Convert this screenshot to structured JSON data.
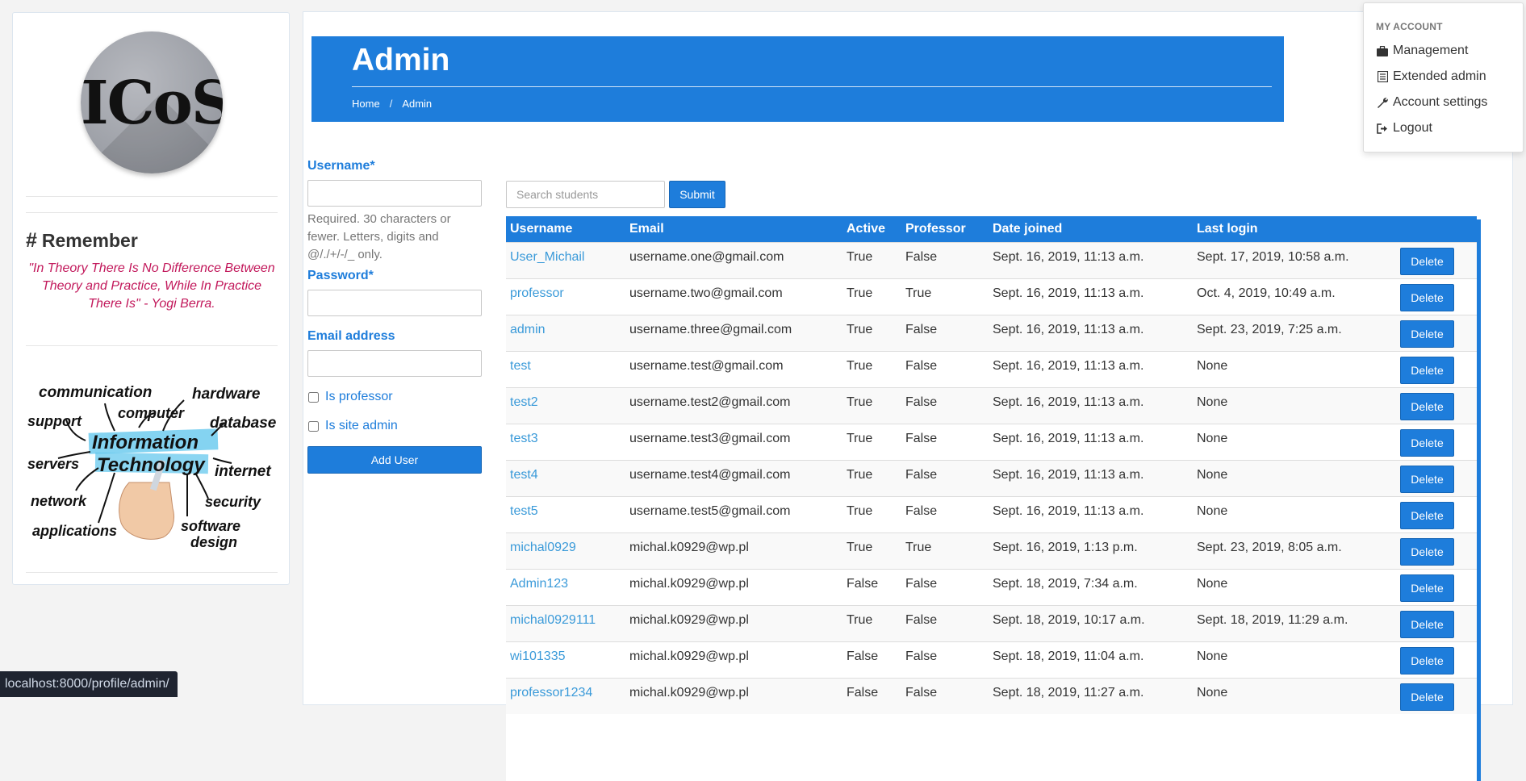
{
  "sidebar": {
    "logo_text": "ICoS",
    "remember_hash": "#",
    "remember_title": "Remember",
    "quote": "\"In Theory There Is No Difference Between Theory and Practice, While In Practice There Is\" - Yogi Berra.",
    "it_words": {
      "communication": "communication",
      "hardware": "hardware",
      "support": "support",
      "computer": "computer",
      "database": "database",
      "information": "Information",
      "technology": "Technology",
      "servers": "servers",
      "internet": "internet",
      "network": "network",
      "security": "security",
      "applications": "applications",
      "software": "software",
      "design": "design"
    }
  },
  "header": {
    "title": "Admin",
    "breadcrumb": [
      "Home",
      "Admin"
    ],
    "breadcrumb_sep": "/"
  },
  "form": {
    "username_label": "Username",
    "required_mark": "*",
    "username_help": "Required. 30 characters or fewer. Letters, digits and @/./+/-/_ only.",
    "password_label": "Password",
    "email_label": "Email address",
    "is_professor_label": "Is professor",
    "is_site_admin_label": "Is site admin",
    "add_user_label": "Add User"
  },
  "search": {
    "placeholder": "Search students",
    "submit_label": "Submit"
  },
  "table": {
    "columns": [
      "Username",
      "Email",
      "Active",
      "Professor",
      "Date joined",
      "Last login",
      ""
    ],
    "delete_label": "Delete",
    "rows": [
      {
        "username": "User_Michail",
        "email": "username.one@gmail.com",
        "active": "True",
        "professor": "False",
        "joined": "Sept. 16, 2019, 11:13 a.m.",
        "last_login": "Sept. 17, 2019, 10:58 a.m."
      },
      {
        "username": "professor",
        "email": "username.two@gmail.com",
        "active": "True",
        "professor": "True",
        "joined": "Sept. 16, 2019, 11:13 a.m.",
        "last_login": "Oct. 4, 2019, 10:49 a.m."
      },
      {
        "username": "admin",
        "email": "username.three@gmail.com",
        "active": "True",
        "professor": "False",
        "joined": "Sept. 16, 2019, 11:13 a.m.",
        "last_login": "Sept. 23, 2019, 7:25 a.m."
      },
      {
        "username": "test",
        "email": "username.test@gmail.com",
        "active": "True",
        "professor": "False",
        "joined": "Sept. 16, 2019, 11:13 a.m.",
        "last_login": "None"
      },
      {
        "username": "test2",
        "email": "username.test2@gmail.com",
        "active": "True",
        "professor": "False",
        "joined": "Sept. 16, 2019, 11:13 a.m.",
        "last_login": "None"
      },
      {
        "username": "test3",
        "email": "username.test3@gmail.com",
        "active": "True",
        "professor": "False",
        "joined": "Sept. 16, 2019, 11:13 a.m.",
        "last_login": "None"
      },
      {
        "username": "test4",
        "email": "username.test4@gmail.com",
        "active": "True",
        "professor": "False",
        "joined": "Sept. 16, 2019, 11:13 a.m.",
        "last_login": "None"
      },
      {
        "username": "test5",
        "email": "username.test5@gmail.com",
        "active": "True",
        "professor": "False",
        "joined": "Sept. 16, 2019, 11:13 a.m.",
        "last_login": "None"
      },
      {
        "username": "michal0929",
        "email": "michal.k0929@wp.pl",
        "active": "True",
        "professor": "True",
        "joined": "Sept. 16, 2019, 1:13 p.m.",
        "last_login": "Sept. 23, 2019, 8:05 a.m."
      },
      {
        "username": "Admin123",
        "email": "michal.k0929@wp.pl",
        "active": "False",
        "professor": "False",
        "joined": "Sept. 18, 2019, 7:34 a.m.",
        "last_login": "None"
      },
      {
        "username": "michal0929111",
        "email": "michal.k0929@wp.pl",
        "active": "True",
        "professor": "False",
        "joined": "Sept. 18, 2019, 10:17 a.m.",
        "last_login": "Sept. 18, 2019, 11:29 a.m."
      },
      {
        "username": "wi101335",
        "email": "michal.k0929@wp.pl",
        "active": "False",
        "professor": "False",
        "joined": "Sept. 18, 2019, 11:04 a.m.",
        "last_login": "None"
      },
      {
        "username": "professor1234",
        "email": "michal.k0929@wp.pl",
        "active": "False",
        "professor": "False",
        "joined": "Sept. 18, 2019, 11:27 a.m.",
        "last_login": "None"
      }
    ]
  },
  "account_menu": {
    "header": "MY ACCOUNT",
    "items": [
      {
        "label": "Management",
        "icon": "briefcase-icon"
      },
      {
        "label": "Extended admin",
        "icon": "list-icon"
      },
      {
        "label": "Account settings",
        "icon": "wrench-icon"
      },
      {
        "label": "Logout",
        "icon": "logout-icon"
      }
    ]
  },
  "statusbar": {
    "url": "localhost:8000/profile/admin/"
  },
  "colors": {
    "primary": "#1e7ddb",
    "quote": "#c2185b",
    "link": "#3a9ad9"
  }
}
